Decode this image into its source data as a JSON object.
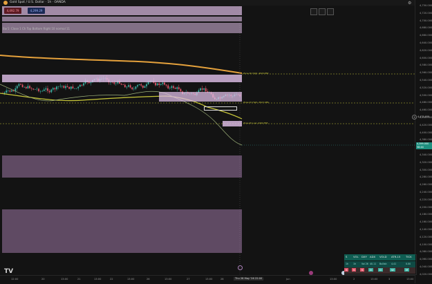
{
  "symbol": {
    "name": "Gold Spot / U.S. Dollar",
    "interval": "1h",
    "exchange": "OANDA",
    "sell_price": "4,492.79",
    "buy_price": "4,299.29"
  },
  "indicator_title": "Bar1: Close 1 Ch Top Bottom Right 10 normal 11",
  "toolbar": {
    "icons": [
      "fullscreen-icon",
      "layout-icon",
      "snapshot-icon"
    ]
  },
  "zones": {
    "level_1": "Zone 4h High: 4629.882",
    "level_2": "Zone 1h High: 4527.486",
    "level_3": "Zone 4h Low: 4492.588"
  },
  "price_axis": {
    "labels": [
      "4,750.000",
      "4,720.000",
      "4,700.000",
      "4,680.000",
      "4,660.000",
      "4,640.000",
      "4,620.000",
      "4,600.000",
      "4,580.000",
      "4,560.000",
      "4,540.000",
      "4,520.000",
      "4,500.000",
      "4,480.000",
      "4,460.000",
      "4,440.000",
      "4,420.000",
      "4,400.000",
      "4,380.000",
      "4,360.000",
      "4,340.000",
      "4,320.000",
      "4,300.000",
      "4,280.000",
      "4,260.000",
      "4,240.000",
      "4,220.000",
      "4,200.000",
      "4,180.000",
      "4,160.000",
      "4,140.000",
      "4,120.000",
      "4,100.000",
      "4,080.000",
      "4,060.000",
      "4,040.000",
      "4,020.000"
    ],
    "current_price": "4,399.000",
    "current_time": "58:44",
    "marker_price": "4,475.955"
  },
  "time_axis": {
    "labels": [
      "12:00",
      "20",
      "13:00",
      "21",
      "13:00",
      "22",
      "13:00",
      "26",
      "13:00",
      "27",
      "13:00",
      "28",
      "13:00",
      "Jun",
      "13:00",
      "2",
      "13:00",
      "3",
      "13:00"
    ],
    "cursor_label": "Thu 28 May '26  22:00"
  },
  "watchlist": {
    "headers": [
      "S",
      "VOL",
      "DXY",
      "ADX",
      "VOLD",
      "ATR-15",
      "TICK"
    ],
    "row1": [
      "1h",
      "1h",
      "Vol 26",
      "40.11",
      "Bullish",
      "4.41",
      "0.00"
    ],
    "row2": [
      "S",
      "S",
      "S",
      "D",
      "D",
      "W",
      "M"
    ]
  },
  "colors": {
    "ema_orange": "#e6a23c",
    "ema_yellow": "#c9c83a",
    "bull": "#3bb3a3",
    "bear": "#e2566a",
    "zone_pink": "#dcbfe6",
    "watch_header": "#0f5d52"
  },
  "logo_text": "TV"
}
